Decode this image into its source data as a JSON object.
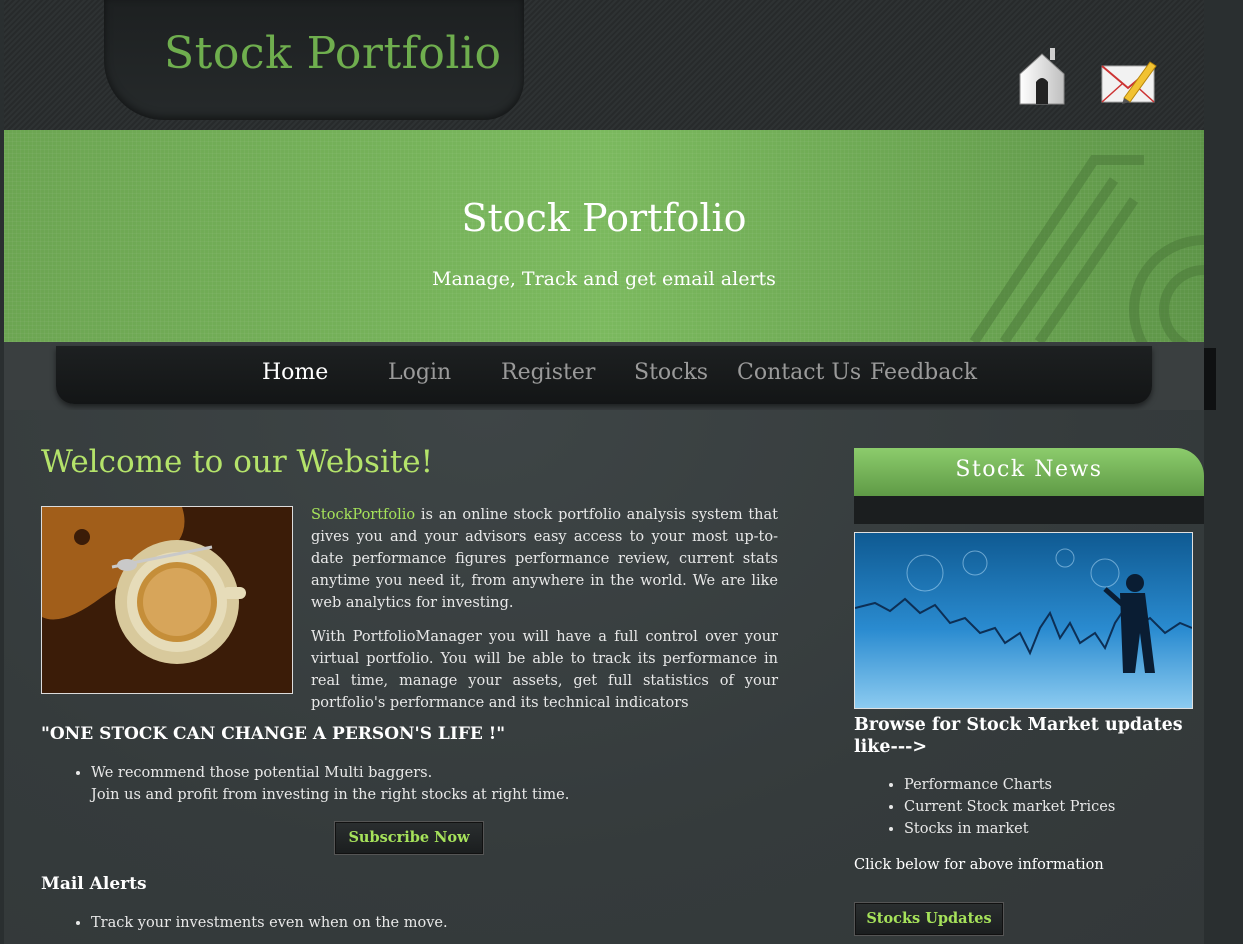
{
  "header": {
    "site_title": "Stock Portfolio",
    "icons": [
      "home-icon",
      "mail-icon"
    ]
  },
  "banner": {
    "title": "Stock Portfolio",
    "subtitle": "Manage, Track and get email alerts"
  },
  "nav": {
    "items": [
      {
        "label": "Home",
        "active": true
      },
      {
        "label": "Login"
      },
      {
        "label": "Register"
      },
      {
        "label": "Stocks"
      },
      {
        "label": "Contact Us"
      },
      {
        "label": "Feedback"
      }
    ]
  },
  "main": {
    "welcome": "Welcome to our Website!",
    "intro": {
      "brand": "StockPortfolio",
      "p1_rest": " is an online stock portfolio analysis system that gives you and your advisors easy access to your most up-to-date performance figures performance review, current stats anytime you need it, from anywhere in the world. We are like web analytics for investing.",
      "p2": "With PortfolioManager you will have a full control over your virtual portfolio. You will be able to track its performance in real time, manage your assets, get full statistics of your portfolio's performance and its technical indicators"
    },
    "slogan": "\"ONE STOCK CAN CHANGE A PERSON'S LIFE !\"",
    "recommend": {
      "line1": "We recommend those potential Multi baggers.",
      "line2": "Join us and profit from investing in the right stocks at right time."
    },
    "subscribe_label": "Subscribe Now",
    "mail_alerts_title": "Mail Alerts",
    "mail_alerts_items": [
      "Track your investments even when on the move."
    ]
  },
  "sidebar": {
    "news_title": "Stock News",
    "browse_text": "Browse for Stock Market updates like--->",
    "items": [
      "Performance Charts",
      "Current Stock market Prices",
      "Stocks in market"
    ],
    "click_text": "Click below for above information",
    "updates_label": "Stocks Updates"
  },
  "colors": {
    "accent_green": "#a6e25a",
    "site_title_green": "#6fae4e",
    "banner_green": "#7bb95e",
    "background": "#353b3c"
  }
}
